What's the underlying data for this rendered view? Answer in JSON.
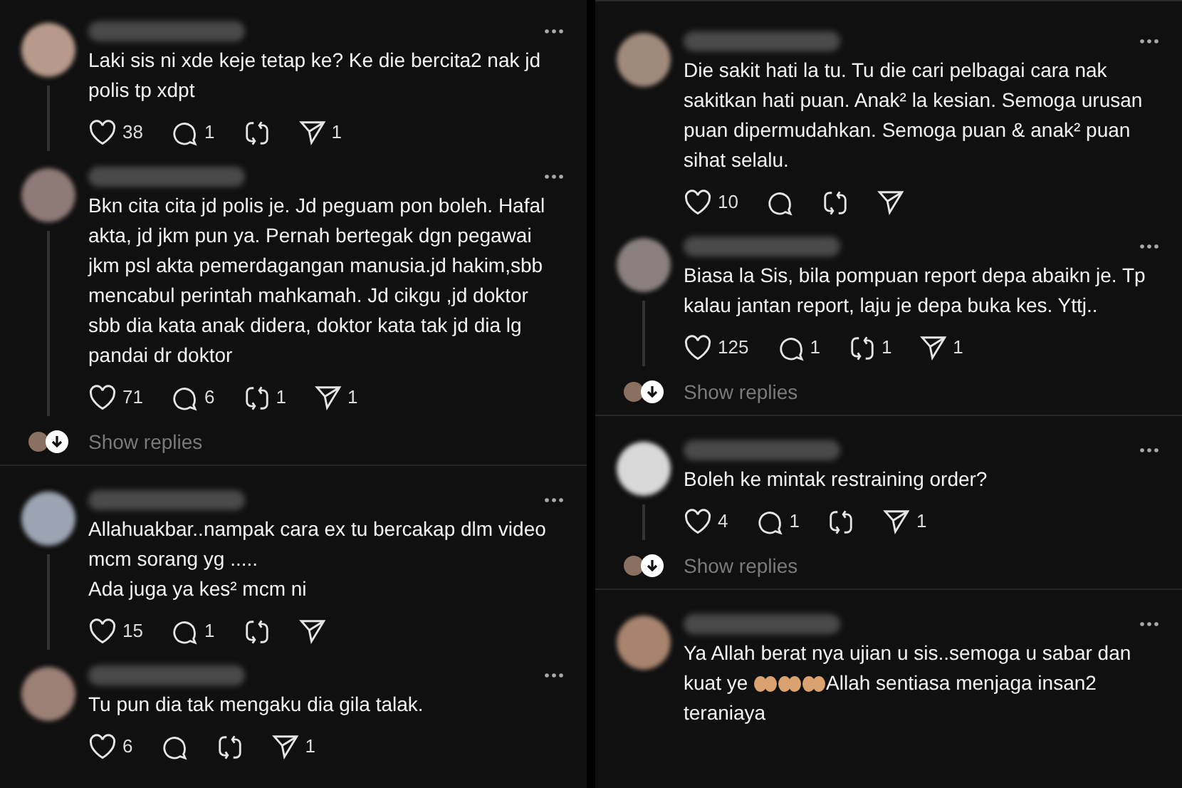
{
  "columns": [
    {
      "posts": [
        {
          "thread": true,
          "body": [
            {
              "kind": "text",
              "text": "Laki sis ni xde keje tetap ke? Ke die bercita2 nak jd polis tp xdpt"
            }
          ],
          "actions": [
            {
              "kind": "like",
              "count": "38"
            },
            {
              "kind": "reply",
              "count": "1"
            },
            {
              "kind": "repost"
            },
            {
              "kind": "share",
              "count": "1"
            }
          ]
        },
        {
          "thread": true,
          "body": [
            {
              "kind": "text",
              "text": "Bkn cita cita jd polis je. Jd peguam pon boleh. Hafal akta, jd jkm pun ya. Pernah bertegak dgn pegawai jkm psl akta pemerdagangan manusia.jd hakim,sbb mencabul perintah mahkamah. Jd cikgu ,jd doktor sbb dia kata anak didera, doktor kata tak jd dia lg pandai dr doktor"
            }
          ],
          "actions": [
            {
              "kind": "like",
              "count": "71"
            },
            {
              "kind": "reply",
              "count": "6"
            },
            {
              "kind": "repost",
              "count": "1"
            },
            {
              "kind": "share",
              "count": "1"
            }
          ],
          "show_replies": "Show replies"
        },
        {
          "thread": true,
          "body": [
            {
              "kind": "text",
              "text": "Allahuakbar..nampak cara ex tu bercakap dlm video mcm sorang yg ....."
            },
            {
              "kind": "text",
              "text": "Ada juga ya kes² mcm ni"
            }
          ],
          "actions": [
            {
              "kind": "like",
              "count": "15"
            },
            {
              "kind": "reply",
              "count": "1"
            },
            {
              "kind": "repost"
            },
            {
              "kind": "share"
            }
          ]
        },
        {
          "thread": false,
          "body": [
            {
              "kind": "text",
              "text": "Tu pun dia tak mengaku dia gila talak."
            }
          ],
          "actions": [
            {
              "kind": "like",
              "count": "6"
            },
            {
              "kind": "reply"
            },
            {
              "kind": "repost"
            },
            {
              "kind": "share",
              "count": "1"
            }
          ]
        }
      ]
    },
    {
      "posts": [
        {
          "thread": false,
          "body": [
            {
              "kind": "text",
              "text": "Die sakit hati la tu. Tu die cari pelbagai cara nak sakitkan hati puan. Anak² la kesian. Semoga urusan puan dipermudahkan. Semoga puan & anak² puan sihat selalu."
            }
          ],
          "actions": [
            {
              "kind": "like",
              "count": "10"
            },
            {
              "kind": "reply"
            },
            {
              "kind": "repost"
            },
            {
              "kind": "share"
            }
          ]
        },
        {
          "thread": true,
          "body": [
            {
              "kind": "text",
              "text": "Biasa la Sis, bila pompuan report depa abaikn je. Tp kalau jantan report, laju je depa buka kes. Yttj.."
            }
          ],
          "actions": [
            {
              "kind": "like",
              "count": "125"
            },
            {
              "kind": "reply",
              "count": "1"
            },
            {
              "kind": "repost",
              "count": "1"
            },
            {
              "kind": "share",
              "count": "1"
            }
          ],
          "show_replies": "Show replies"
        },
        {
          "thread": true,
          "body": [
            {
              "kind": "text",
              "text": "Boleh ke mintak restraining order?"
            }
          ],
          "actions": [
            {
              "kind": "like",
              "count": "4"
            },
            {
              "kind": "reply",
              "count": "1"
            },
            {
              "kind": "repost"
            },
            {
              "kind": "share",
              "count": "1"
            }
          ],
          "show_replies": "Show replies"
        },
        {
          "thread": false,
          "body": [
            {
              "kind": "inline",
              "parts": [
                {
                  "kind": "text",
                  "text": "Ya Allah berat nya ujian u sis..semoga u sabar dan kuat ye "
                },
                {
                  "kind": "hands"
                },
                {
                  "kind": "hands"
                },
                {
                  "kind": "hands"
                },
                {
                  "kind": "text",
                  "text": "Allah sentiasa menjaga insan2 teraniaya"
                }
              ]
            }
          ]
        }
      ]
    }
  ]
}
